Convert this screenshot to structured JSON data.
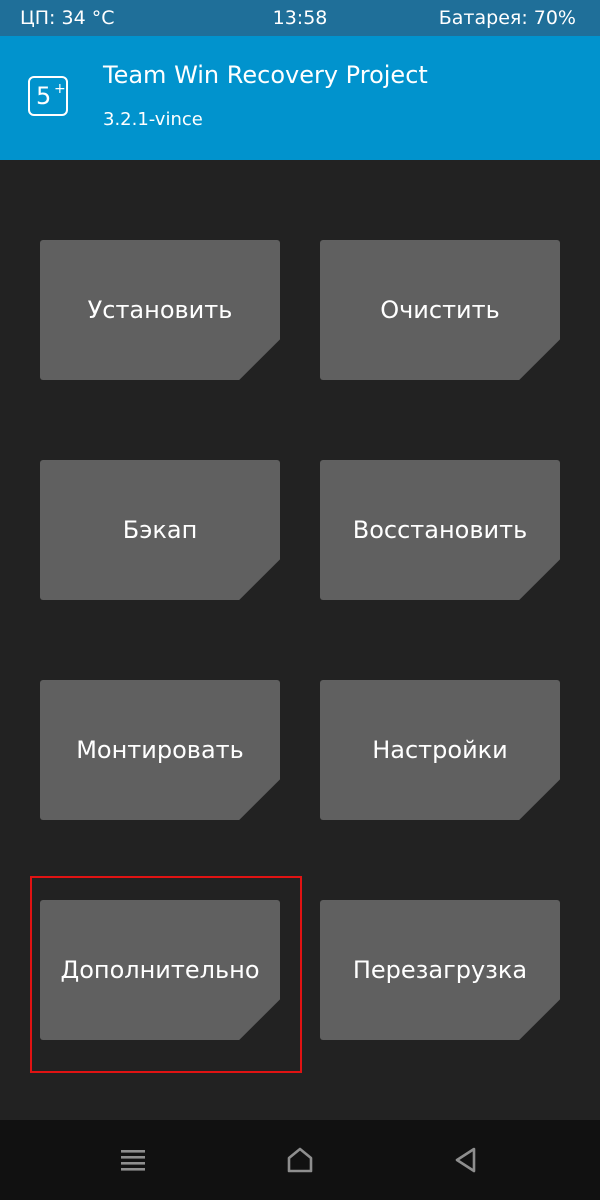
{
  "status_bar": {
    "cpu": "ЦП: 34 °C",
    "time": "13:58",
    "battery": "Батарея: 70%"
  },
  "header": {
    "logo_text": "5",
    "logo_plus": "+",
    "title": "Team Win Recovery Project",
    "version": "3.2.1-vince"
  },
  "tiles": [
    {
      "label": "Установить"
    },
    {
      "label": "Очистить"
    },
    {
      "label": "Бэкап"
    },
    {
      "label": "Восстановить"
    },
    {
      "label": "Монтировать"
    },
    {
      "label": "Настройки"
    },
    {
      "label": "Дополнительно"
    },
    {
      "label": "Перезагрузка"
    }
  ],
  "highlighted_tile": "Дополнительно",
  "nav_bar": {
    "icons": [
      "menu-icon",
      "home-icon",
      "back-icon"
    ]
  },
  "colors": {
    "status_bar": "#1f6f99",
    "header": "#0193cd",
    "background": "#222222",
    "tile": "#606060",
    "highlight": "#e01313",
    "nav_bar": "#111111",
    "icon": "#8e8e8e"
  }
}
